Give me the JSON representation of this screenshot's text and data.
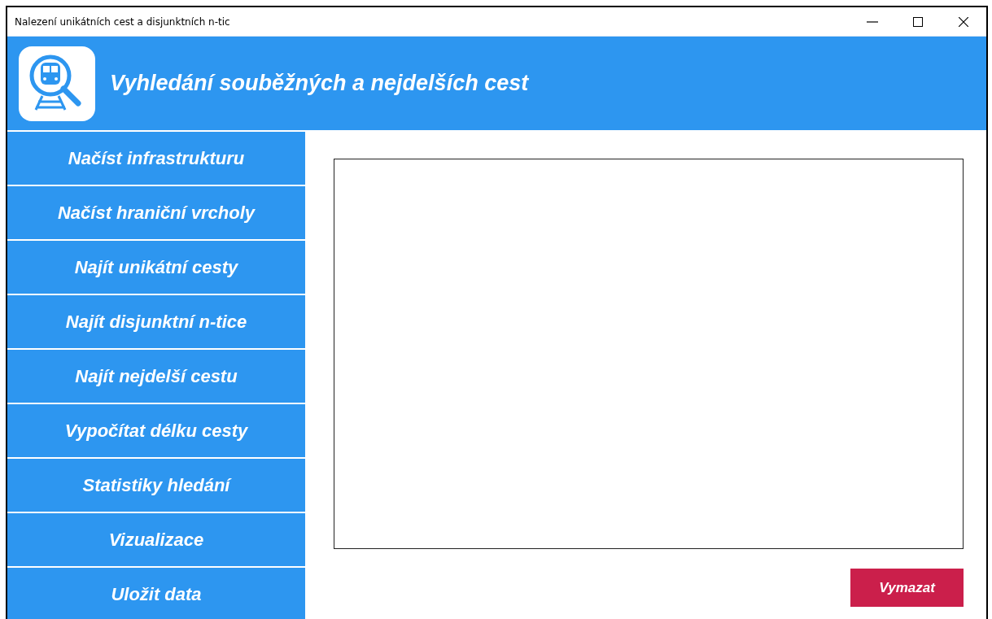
{
  "window": {
    "title": "Nalezení unikátních cest a disjunktních n-tic"
  },
  "header": {
    "title": "Vyhledání souběžných a nejdelších cest"
  },
  "sidebar": {
    "items": [
      {
        "label": "Načíst infrastrukturu"
      },
      {
        "label": "Načíst hraniční vrcholy"
      },
      {
        "label": "Najít unikátní cesty"
      },
      {
        "label": "Najít disjunktní n-tice"
      },
      {
        "label": "Najít nejdelší cestu"
      },
      {
        "label": "Vypočítat délku cesty"
      },
      {
        "label": "Statistiky hledání"
      },
      {
        "label": "Vizualizace"
      },
      {
        "label": "Uložit data"
      }
    ]
  },
  "output": {
    "clear_button": "Vymazat"
  }
}
